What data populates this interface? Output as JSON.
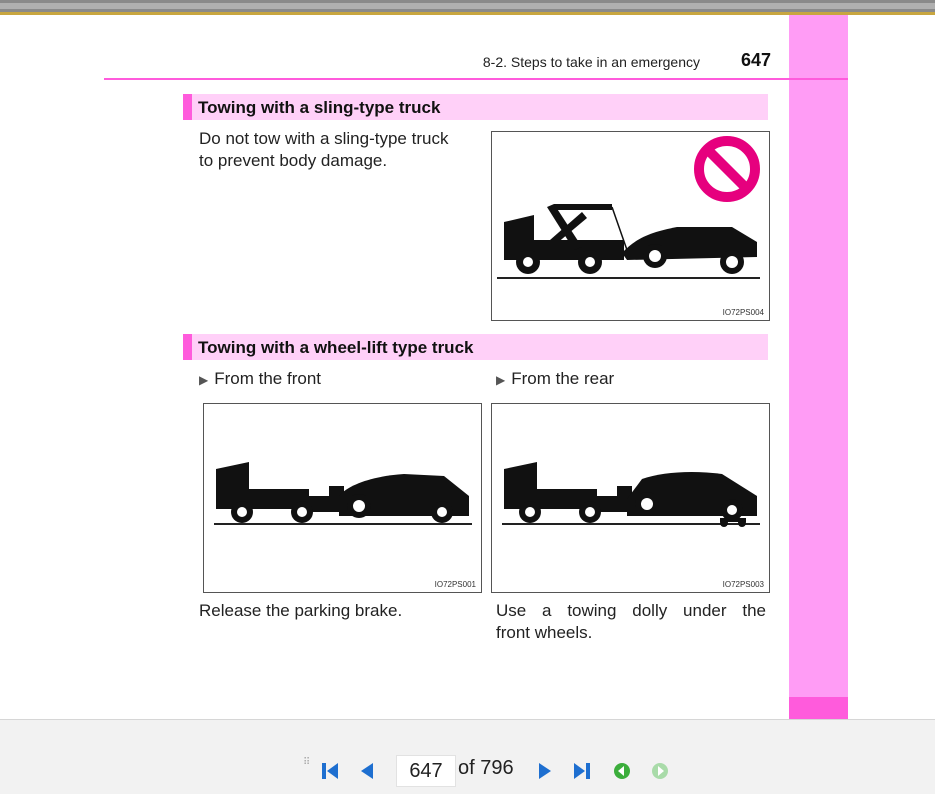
{
  "header": {
    "section_title": "8-2. Steps to take in an emergency",
    "page_number": "647"
  },
  "section1": {
    "title": "Towing with a sling-type truck",
    "paragraph_line1": "Do not tow with a sling-type truck",
    "paragraph_line2": "to prevent body damage.",
    "figure_code": "IO72PS004"
  },
  "section2": {
    "title": "Towing with a wheel-lift type truck",
    "left": {
      "bullet": "From the front",
      "figure_code": "IO72PS001",
      "caption": "Release the parking brake."
    },
    "right": {
      "bullet": "From the rear",
      "figure_code": "IO72PS003",
      "caption_line1": "Use a towing dolly under the",
      "caption_line2": "front wheels."
    }
  },
  "nav": {
    "current_page": "647",
    "of_total": "of 796"
  },
  "colors": {
    "accent": "#ff5bdc",
    "sidetab": "#ff9cf5",
    "section_bg": "#ffd0f8",
    "nav_blue": "#1e6fd0",
    "nav_green": "#3cae3c"
  }
}
